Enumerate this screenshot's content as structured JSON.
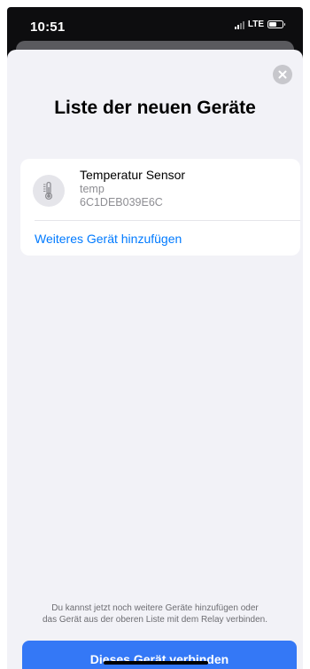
{
  "status_bar": {
    "time": "10:51",
    "network": "LTE"
  },
  "sheet": {
    "title": "Liste der neuen Geräte",
    "close_icon": "close-icon"
  },
  "devices": [
    {
      "name": "Temperatur Sensor",
      "type": "temp",
      "id": "6C1DEB039E6C",
      "icon": "thermometer-icon"
    }
  ],
  "add_device_label": "Weiteres Gerät hinzufügen",
  "hint_line1": "Du kannst jetzt noch weitere Geräte hinzufügen oder",
  "hint_line2": "das Gerät aus der oberen Liste mit dem Relay verbinden.",
  "connect_button_label": "Dieses Gerät verbinden",
  "colors": {
    "accent": "#007aff",
    "button": "#3478f6",
    "background": "#f2f2f7"
  }
}
